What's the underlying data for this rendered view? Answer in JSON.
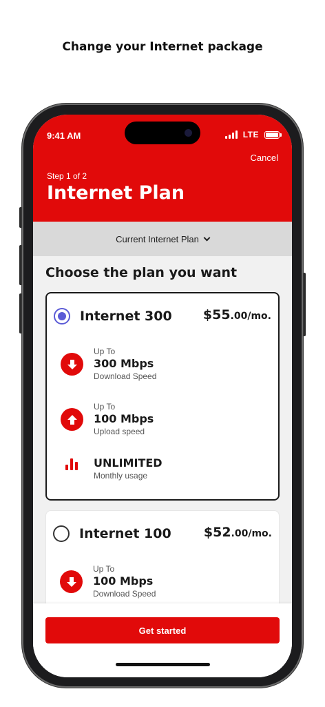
{
  "caption": "Change your Internet package",
  "status_bar": {
    "time": "9:41 AM",
    "network": "LTE"
  },
  "header": {
    "cancel_label": "Cancel",
    "step": "Step 1 of 2",
    "title": "Internet Plan"
  },
  "current_plan": {
    "label": "Current Internet Plan"
  },
  "section_title": "Choose the plan you want",
  "plans": [
    {
      "name": "Internet 300",
      "price_main": "$55",
      "price_cents": ".00/mo.",
      "selected": true,
      "features": [
        {
          "icon": "download-arrow-icon",
          "pre": "Up To",
          "main": "300 Mbps",
          "sub": "Download Speed"
        },
        {
          "icon": "upload-arrow-icon",
          "pre": "Up To",
          "main": "100 Mbps",
          "sub": "Upload speed"
        },
        {
          "icon": "bar-chart-icon",
          "main": "UNLIMITED",
          "sub": "Monthly usage"
        }
      ]
    },
    {
      "name": "Internet 100",
      "price_main": "$52",
      "price_cents": ".00/mo.",
      "selected": false,
      "features": [
        {
          "icon": "download-arrow-icon",
          "pre": "Up To",
          "main": "100 Mbps",
          "sub": "Download Speed"
        }
      ]
    }
  ],
  "cta_label": "Get started",
  "colors": {
    "brand_red": "#e10a0a",
    "radio_selected": "#5b5bd6",
    "dropdown_bg": "#d9d9d9"
  }
}
